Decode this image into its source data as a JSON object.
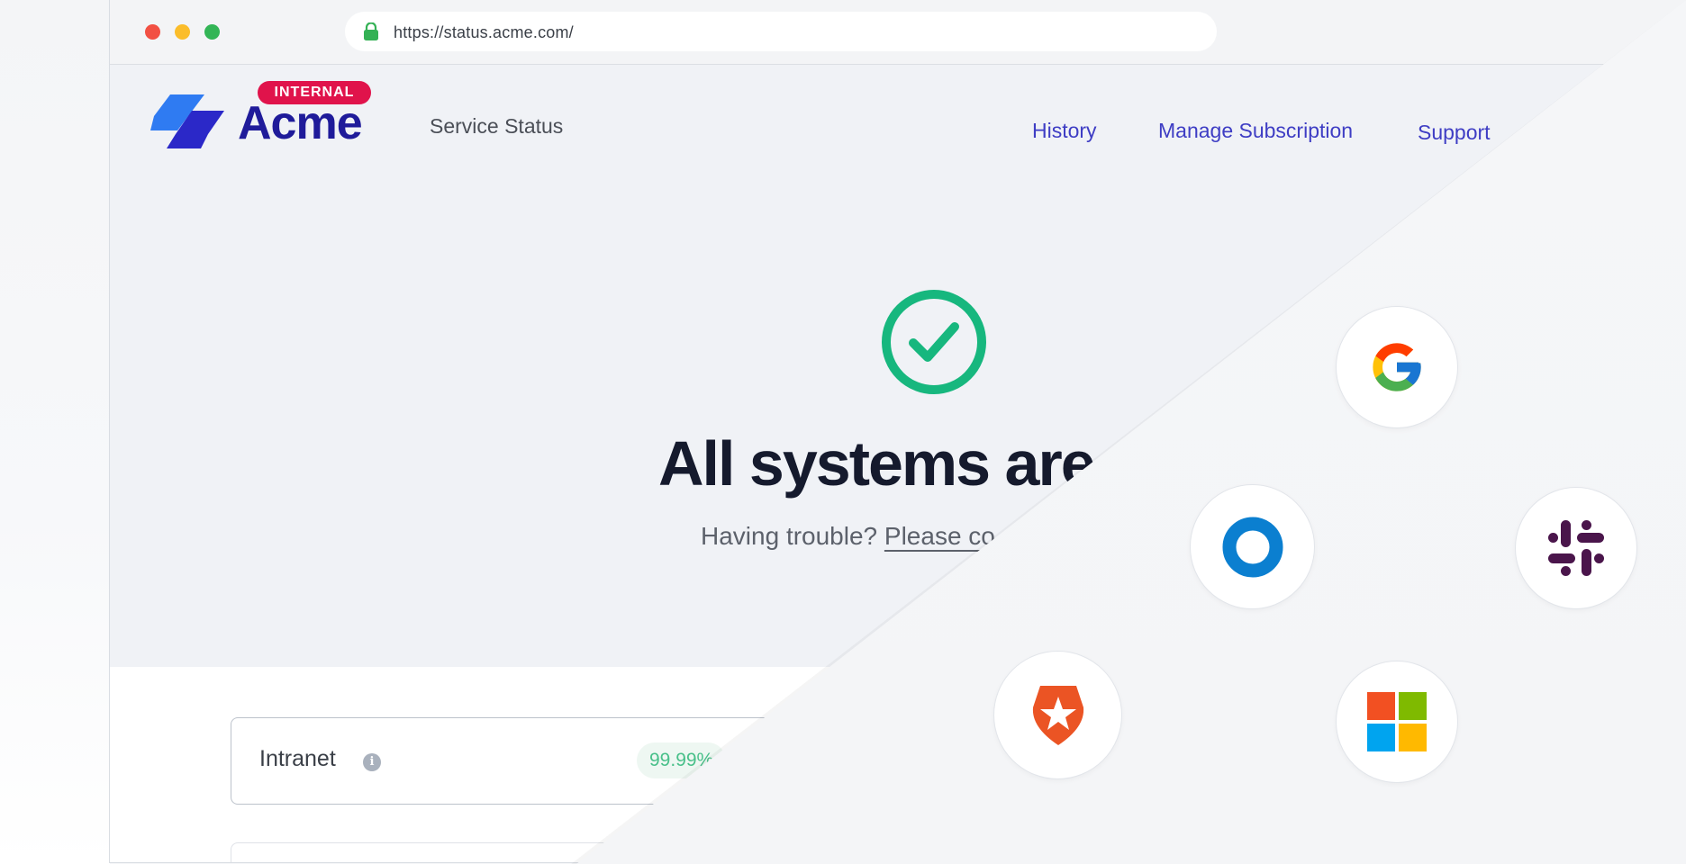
{
  "browser": {
    "url": "https://status.acme.com/"
  },
  "header": {
    "badge": "INTERNAL",
    "brand": "Acme",
    "subtitle": "Service Status",
    "nav": [
      {
        "label": "History"
      },
      {
        "label": "Manage Subscription"
      },
      {
        "label": "Support"
      }
    ]
  },
  "hero": {
    "title": "All systems are",
    "subtitle_prefix": "Having trouble? ",
    "subtitle_link": "Please co"
  },
  "components": [
    {
      "name": "Intranet",
      "info": "i",
      "uptime": "99.99%"
    }
  ],
  "integrations": [
    "google-icon",
    "okta-icon",
    "slack-icon",
    "auth0-icon",
    "microsoft-icon"
  ],
  "colors": {
    "brand": "#1f1b9a",
    "badge": "#e0134b",
    "nav_link": "#3e3dc4",
    "success": "#17b77e"
  }
}
